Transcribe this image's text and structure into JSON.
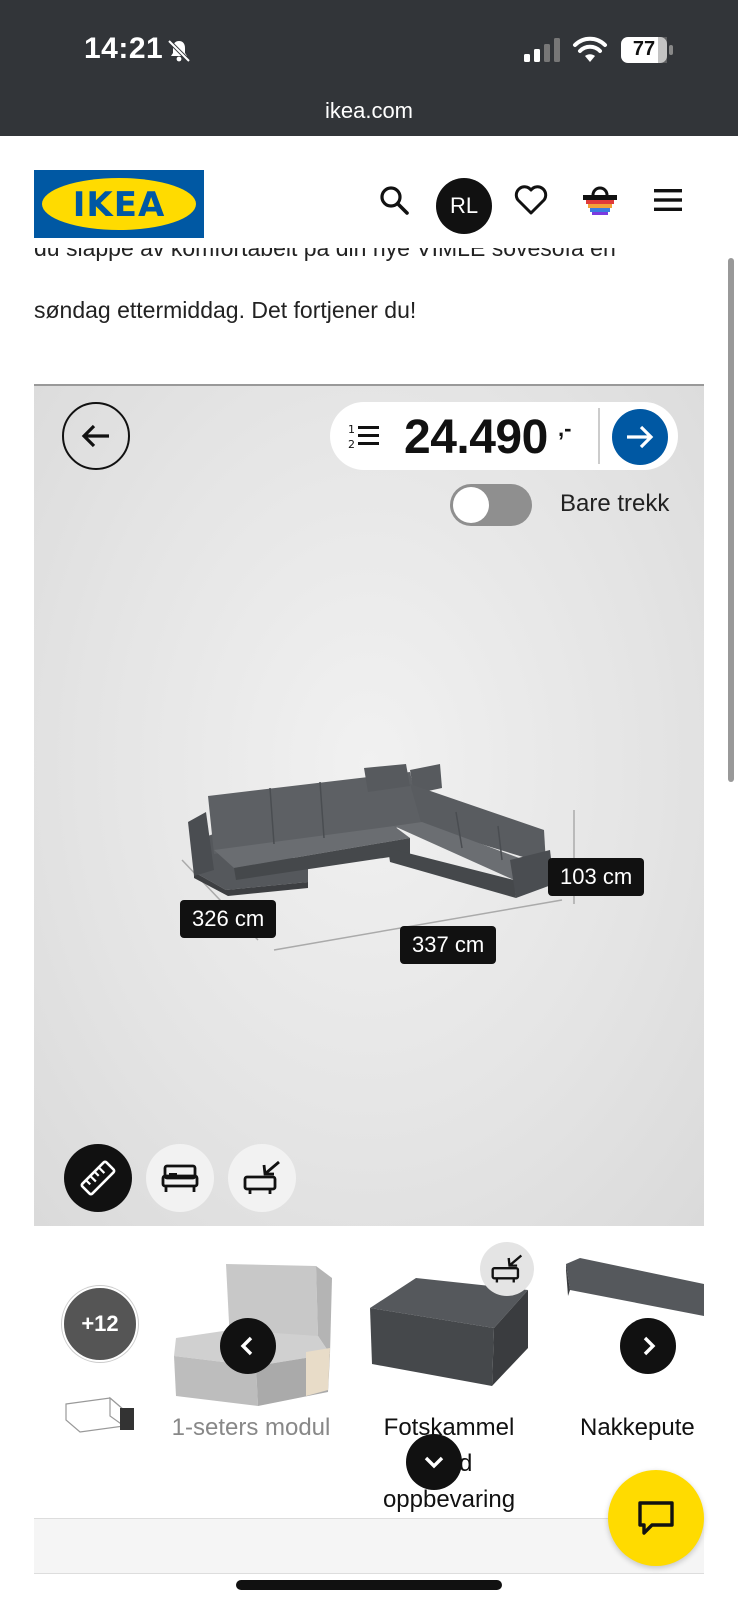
{
  "status_bar": {
    "time": "14:21",
    "battery": "77",
    "url": "ikea.com"
  },
  "header": {
    "logo_text": "IKEA",
    "avatar_initials": "RL"
  },
  "intro": {
    "cut_line": "du slappe av komfortabelt på din nye VIMLE sovesofa en",
    "line": "søndag ettermiddag. Det fortjener du!"
  },
  "viewer": {
    "price": "24.490",
    "price_suffix": ",-",
    "toggle_label": "Bare trekk",
    "toggle_on": false,
    "dimensions": {
      "depth": "326 cm",
      "width": "337 cm",
      "height": "103 cm"
    }
  },
  "carousel": {
    "more_count": "+12",
    "items": [
      {
        "label": "1-seters modul"
      },
      {
        "label_line1": "Fotskammel",
        "label_line2": "med",
        "label_line3": "oppbevaring"
      },
      {
        "label": "Nakkepute"
      }
    ]
  },
  "colors": {
    "brand_blue": "#0058a3",
    "brand_yellow": "#ffdb00",
    "status_bar": "#323539"
  }
}
